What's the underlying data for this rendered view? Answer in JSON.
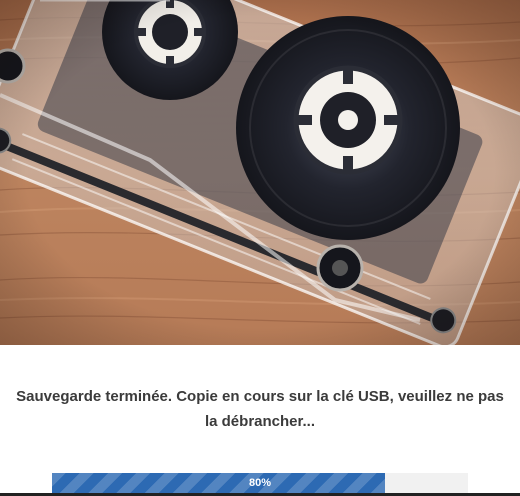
{
  "status": {
    "message_line1": "Sauvegarde terminée. Copie en cours sur la clé USB, veuillez ne pas",
    "message_line2": "la débrancher..."
  },
  "progress": {
    "value": 0.8,
    "label": "80%",
    "fill_color": "#2d6ab3",
    "track_color": "#f1f1f1"
  },
  "hero": {
    "subject": "cassette-tape-on-wood"
  }
}
